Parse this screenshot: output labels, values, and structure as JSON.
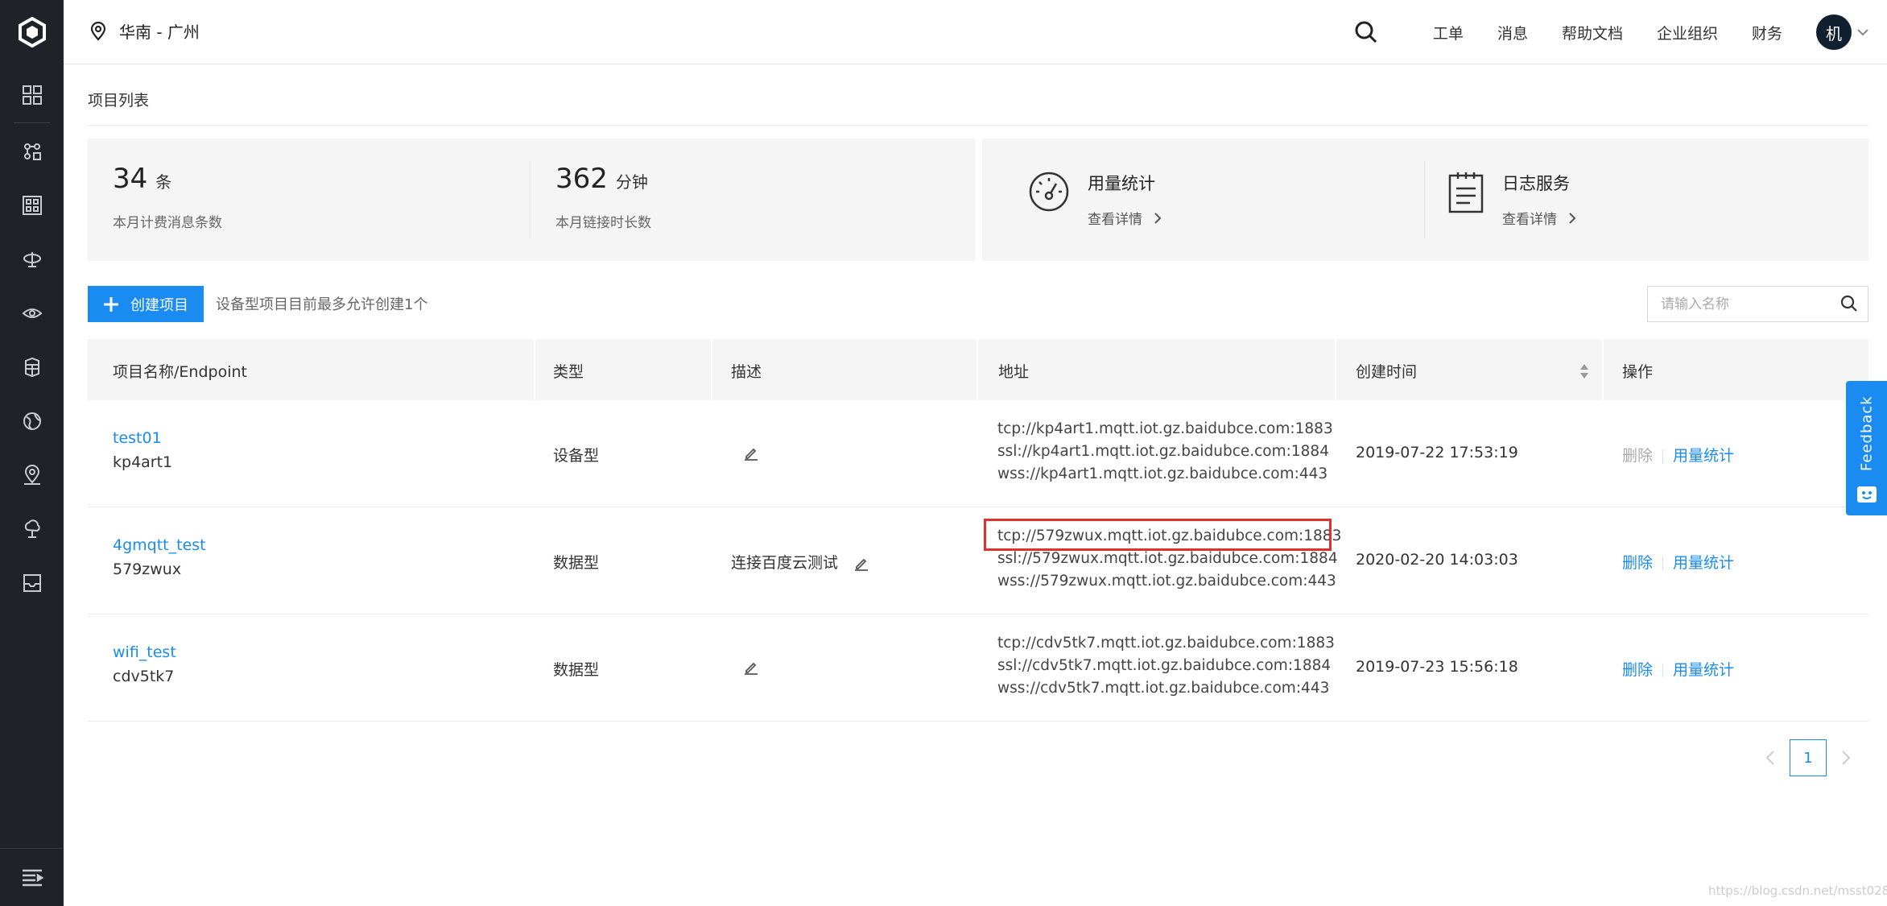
{
  "region": "华南 - 广州",
  "top_nav": [
    "工单",
    "消息",
    "帮助文档",
    "企业组织",
    "财务"
  ],
  "avatar_text": "机",
  "page_title": "项目列表",
  "stats": [
    {
      "value": "34",
      "unit": "条",
      "label": "本月计费消息条数"
    },
    {
      "value": "362",
      "unit": "分钟",
      "label": "本月链接时长数"
    }
  ],
  "services": [
    {
      "title": "用量统计",
      "link": "查看详情",
      "icon": "gauge-icon"
    },
    {
      "title": "日志服务",
      "link": "查看详情",
      "icon": "clipboard-icon"
    }
  ],
  "toolbar": {
    "create_label": "创建项目",
    "hint": "设备型项目目前最多允许创建1个",
    "search_placeholder": "请输入名称"
  },
  "table": {
    "headers": [
      "项目名称/Endpoint",
      "类型",
      "描述",
      "地址",
      "创建时间",
      "操作"
    ],
    "rows": [
      {
        "name": "test01",
        "endpoint": "kp4art1",
        "type": "设备型",
        "desc": "",
        "addresses": [
          "tcp://kp4art1.mqtt.iot.gz.baidubce.com:1883",
          "ssl://kp4art1.mqtt.iot.gz.baidubce.com:1884",
          "wss://kp4art1.mqtt.iot.gz.baidubce.com:443"
        ],
        "created": "2019-07-22 17:53:19",
        "op_delete": "删除",
        "op_usage": "用量统计",
        "delete_enabled": false
      },
      {
        "name": "4gmqtt_test",
        "endpoint": "579zwux",
        "type": "数据型",
        "desc": "连接百度云测试",
        "addresses": [
          "tcp://579zwux.mqtt.iot.gz.baidubce.com:1883",
          "ssl://579zwux.mqtt.iot.gz.baidubce.com:1884",
          "wss://579zwux.mqtt.iot.gz.baidubce.com:443"
        ],
        "created": "2020-02-20 14:03:03",
        "op_delete": "删除",
        "op_usage": "用量统计",
        "delete_enabled": true
      },
      {
        "name": "wifi_test",
        "endpoint": "cdv5tk7",
        "type": "数据型",
        "desc": "",
        "addresses": [
          "tcp://cdv5tk7.mqtt.iot.gz.baidubce.com:1883",
          "ssl://cdv5tk7.mqtt.iot.gz.baidubce.com:1884",
          "wss://cdv5tk7.mqtt.iot.gz.baidubce.com:443"
        ],
        "created": "2019-07-23 15:56:18",
        "op_delete": "删除",
        "op_usage": "用量统计",
        "delete_enabled": true
      }
    ]
  },
  "pagination": {
    "current": "1"
  },
  "feedback_label": "Feedback",
  "watermark": "https://blog.csdn.net/msst028"
}
